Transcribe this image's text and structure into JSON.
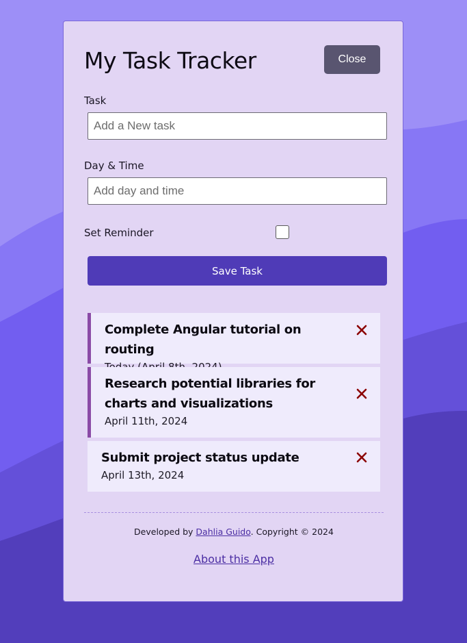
{
  "app": {
    "title": "My Task Tracker",
    "close_label": "Close"
  },
  "form": {
    "task_label": "Task",
    "task_placeholder": "Add a New task",
    "task_value": "",
    "day_label": "Day & Time",
    "day_placeholder": "Add day and time",
    "day_value": "",
    "reminder_label": "Set Reminder",
    "reminder_checked": false,
    "save_label": "Save Task"
  },
  "tasks": [
    {
      "title": "Complete Angular tutorial on routing",
      "day": "Today (April 8th, 2024)",
      "reminder": true
    },
    {
      "title": "Research potential libraries for charts and visualizations",
      "day": "April 11th, 2024",
      "reminder": true
    },
    {
      "title": "Submit project status update",
      "day": "April 13th, 2024",
      "reminder": false
    }
  ],
  "footer": {
    "developed_by": "Developed by ",
    "author": "Dahlia Guido",
    "copyright": ". Copyright © 2024",
    "about_label": "About this App"
  },
  "colors": {
    "accent": "#4f3bb7",
    "reminder_border": "#8a4aa6",
    "delete": "#8b0000",
    "card_bg": "#e2d5f4"
  },
  "icons": {
    "delete": "close-x-icon"
  }
}
